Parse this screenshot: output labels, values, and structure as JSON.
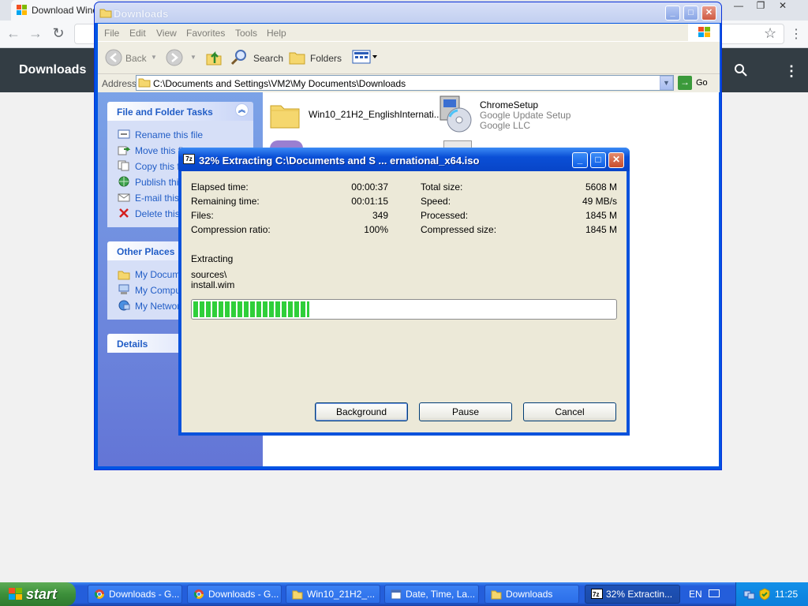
{
  "chrome": {
    "tab_title": "Download Windo",
    "page_header": "Downloads",
    "win_controls": [
      "—",
      "❐",
      "✕"
    ]
  },
  "explorer": {
    "title": "Downloads",
    "menu": [
      "File",
      "Edit",
      "View",
      "Favorites",
      "Tools",
      "Help"
    ],
    "toolbar": {
      "back": "Back",
      "search": "Search",
      "folders": "Folders"
    },
    "address_label": "Address",
    "address_path": "C:\\Documents and Settings\\VM2\\My Documents\\Downloads",
    "go_label": "Go",
    "tasks": {
      "title": "File and Folder Tasks",
      "items": [
        "Rename this file",
        "Move this fi",
        "Copy this fi",
        "Publish this",
        "E-mail this fi",
        "Delete this"
      ]
    },
    "other_places": {
      "title": "Other Places",
      "items": [
        "My Docume",
        "My Comput",
        "My Network"
      ]
    },
    "details_title": "Details",
    "files": [
      {
        "name": "Win10_21H2_EnglishInternati..."
      },
      {
        "name": "ChromeSetup",
        "desc": "Google Update Setup",
        "company": "Google LLC"
      }
    ]
  },
  "dialog": {
    "icon_text": "7z",
    "title": "32% Extracting C:\\Documents and S ... ernational_x64.iso",
    "stats_left": [
      {
        "label": "Elapsed time:",
        "value": "00:00:37"
      },
      {
        "label": "Remaining time:",
        "value": "00:01:15"
      },
      {
        "label": "Files:",
        "value": "349"
      },
      {
        "label": "Compression ratio:",
        "value": "100%"
      }
    ],
    "stats_right": [
      {
        "label": "Total size:",
        "value": "5608 M"
      },
      {
        "label": "Speed:",
        "value": "49 MB/s"
      },
      {
        "label": "Processed:",
        "value": "1845 M"
      },
      {
        "label": "Compressed size:",
        "value": "1845 M"
      }
    ],
    "action": "Extracting",
    "current_dir": "sources\\",
    "current_file": "install.wim",
    "progress": 0.32,
    "buttons": {
      "background": "Background",
      "pause": "Pause",
      "cancel": "Cancel"
    }
  },
  "taskbar": {
    "start": "start",
    "buttons": [
      {
        "label": "Downloads - G...",
        "icon": "chrome-icon"
      },
      {
        "label": "Downloads - G...",
        "icon": "chrome-icon"
      },
      {
        "label": "Win10_21H2_...",
        "icon": "folder-icon"
      },
      {
        "label": "Date, Time, La...",
        "icon": "date-time-icon"
      },
      {
        "label": "Downloads",
        "icon": "folder-icon"
      },
      {
        "label": "32% Extractin...",
        "icon": "7zip-icon"
      }
    ],
    "language": "EN",
    "clock": "11:25"
  }
}
